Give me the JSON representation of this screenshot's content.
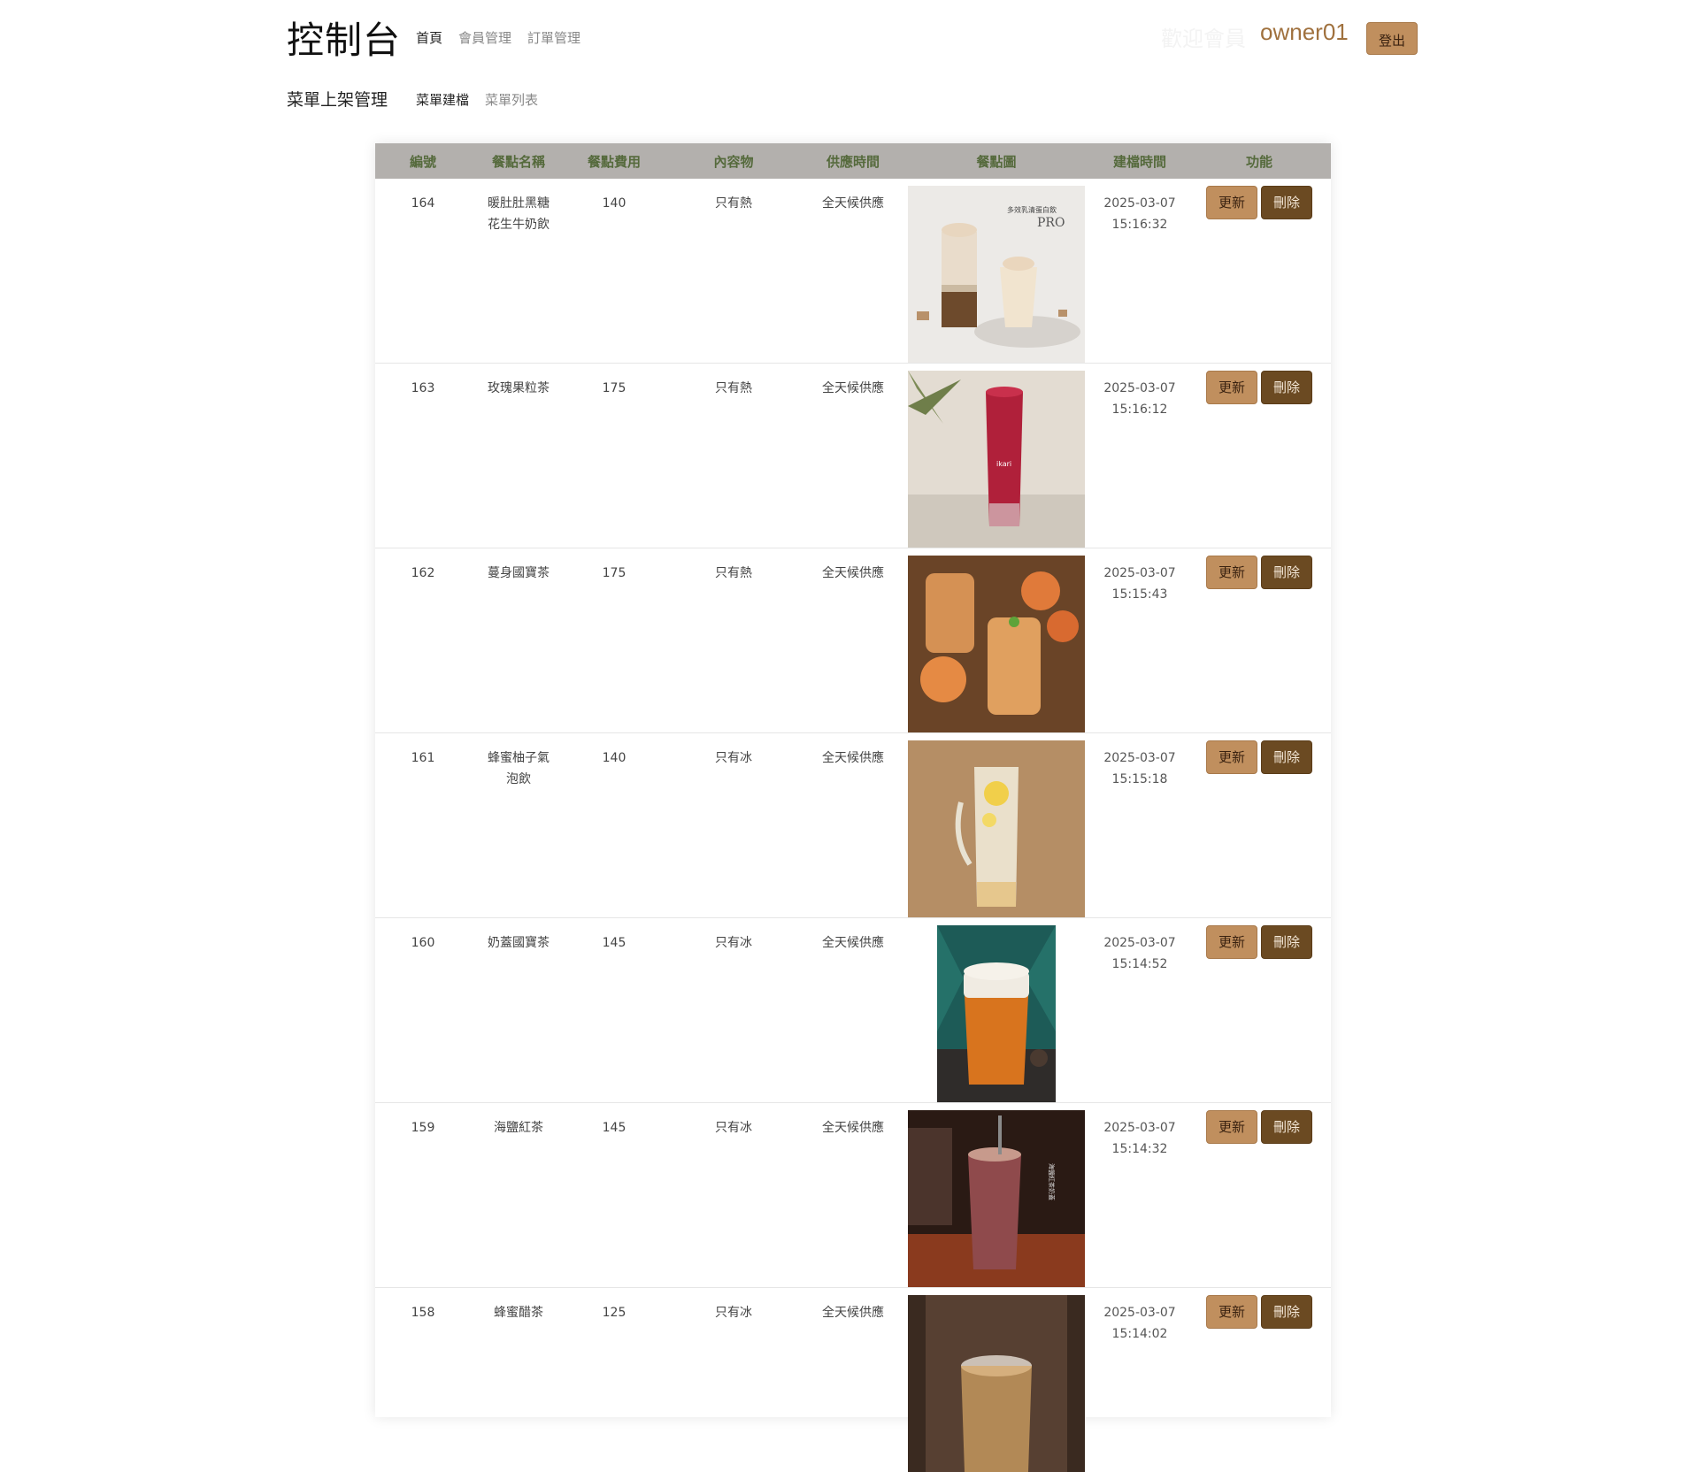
{
  "header": {
    "brand": "控制台",
    "nav": [
      "首頁",
      "會員管理",
      "訂單管理"
    ],
    "welcome": "歡迎會員",
    "username": "owner01",
    "logout": "登出"
  },
  "subheader": {
    "title": "菜單上架管理",
    "nav": [
      "菜單建檔",
      "菜單列表"
    ]
  },
  "table": {
    "columns": [
      "編號",
      "餐點名稱",
      "餐點費用",
      "內容物",
      "供應時間",
      "餐點圖",
      "建檔時間",
      "功能"
    ],
    "update_label": "更新",
    "delete_label": "刪除",
    "rows": [
      {
        "id": "164",
        "name1": "暖肚肚黑糖",
        "name2": "花生牛奶飲",
        "price": "140",
        "content": "只有熱",
        "supply": "全天候供應",
        "date": "2025-03-07",
        "time": "15:16:32",
        "image_overlay": "多效乳清蛋白飲",
        "image_overlay2": "PRO"
      },
      {
        "id": "163",
        "name1": "玫瑰果粒茶",
        "name2": "",
        "price": "175",
        "content": "只有熱",
        "supply": "全天候供應",
        "date": "2025-03-07",
        "time": "15:16:12",
        "image_overlay": "ikari"
      },
      {
        "id": "162",
        "name1": "蔓身國寶茶",
        "name2": "",
        "price": "175",
        "content": "只有熱",
        "supply": "全天候供應",
        "date": "2025-03-07",
        "time": "15:15:43"
      },
      {
        "id": "161",
        "name1": "蜂蜜柚子氣",
        "name2": "泡飲",
        "price": "140",
        "content": "只有冰",
        "supply": "全天候供應",
        "date": "2025-03-07",
        "time": "15:15:18"
      },
      {
        "id": "160",
        "name1": "奶蓋國寶茶",
        "name2": "",
        "price": "145",
        "content": "只有冰",
        "supply": "全天候供應",
        "date": "2025-03-07",
        "time": "15:14:52"
      },
      {
        "id": "159",
        "name1": "海鹽紅茶",
        "name2": "",
        "price": "145",
        "content": "只有冰",
        "supply": "全天候供應",
        "date": "2025-03-07",
        "time": "15:14:32",
        "image_overlay": "海鹽紅茶奶蓋"
      },
      {
        "id": "158",
        "name1": "蜂蜜醋茶",
        "name2": "",
        "price": "125",
        "content": "只有冰",
        "supply": "全天候供應",
        "date": "2025-03-07",
        "time": "15:14:02"
      }
    ]
  },
  "colors": {
    "accent": "#c08f5e",
    "dark_accent": "#6b4a22",
    "header_bg": "#b3b0ad",
    "header_text": "#556a3c",
    "username": "#a0713e"
  }
}
